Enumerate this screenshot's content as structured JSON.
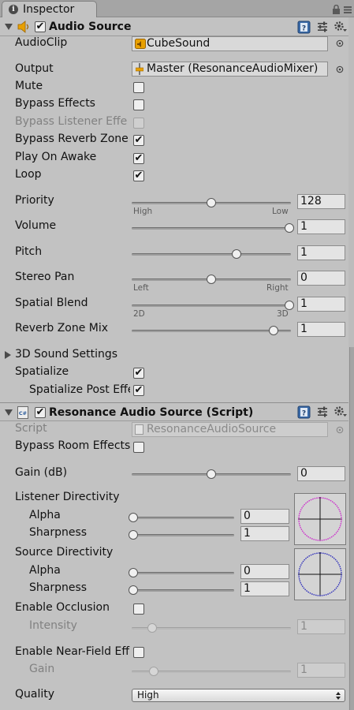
{
  "tab": {
    "title": "Inspector"
  },
  "audio_source": {
    "title": "Audio Source",
    "fields": {
      "audioclip_label": "AudioClip",
      "audioclip_value": "CubeSound",
      "output_label": "Output",
      "output_value": "Master (ResonanceAudioMixer)",
      "mute_label": "Mute",
      "bypass_effects_label": "Bypass Effects",
      "bypass_listener_label": "Bypass Listener Effe",
      "bypass_reverb_label": "Bypass Reverb Zone",
      "play_on_awake_label": "Play On Awake",
      "loop_label": "Loop",
      "priority_label": "Priority",
      "priority_value": "128",
      "priority_min_label": "High",
      "priority_max_label": "Low",
      "volume_label": "Volume",
      "volume_value": "1",
      "pitch_label": "Pitch",
      "pitch_value": "1",
      "stereo_pan_label": "Stereo Pan",
      "stereo_pan_value": "0",
      "stereo_pan_min_label": "Left",
      "stereo_pan_max_label": "Right",
      "spatial_blend_label": "Spatial Blend",
      "spatial_blend_value": "1",
      "spatial_blend_min_label": "2D",
      "spatial_blend_max_label": "3D",
      "reverb_mix_label": "Reverb Zone Mix",
      "reverb_mix_value": "1",
      "sound_settings_label": "3D Sound Settings",
      "spatialize_label": "Spatialize",
      "spatialize_post_label": "Spatialize Post Effe"
    },
    "checks": {
      "enabled": true,
      "mute": false,
      "bypass_effects": false,
      "bypass_listener": false,
      "bypass_reverb": true,
      "play_on_awake": true,
      "loop": true,
      "spatialize": true,
      "spatialize_post": true
    },
    "slider_levels": {
      "priority": 0.5,
      "volume": 1.0,
      "pitch": 0.66,
      "stereo_pan": 0.5,
      "spatial_blend": 1.0,
      "reverb_mix": 0.9
    }
  },
  "resonance": {
    "title": "Resonance Audio Source (Script)",
    "fields": {
      "script_label": "Script",
      "script_value": "ResonanceAudioSource",
      "bypass_room_label": "Bypass Room Effects",
      "gain_label": "Gain (dB)",
      "gain_value": "0",
      "listener_dir_label": "Listener Directivity",
      "listener_alpha_label": "Alpha",
      "listener_alpha_value": "0",
      "listener_sharp_label": "Sharpness",
      "listener_sharp_value": "1",
      "source_dir_label": "Source Directivity",
      "source_alpha_label": "Alpha",
      "source_alpha_value": "0",
      "source_sharp_label": "Sharpness",
      "source_sharp_value": "1",
      "occlusion_label": "Enable Occlusion",
      "intensity_label": "Intensity",
      "intensity_value": "1",
      "nearfield_label": "Enable Near-Field Eff",
      "nf_gain_label": "Gain",
      "nf_gain_value": "1",
      "quality_label": "Quality",
      "quality_value": "High"
    },
    "checks": {
      "enabled": true,
      "bypass_room": false,
      "occlusion": false,
      "nearfield": false
    },
    "slider_levels": {
      "gain": 0.5,
      "listener_alpha": 0.0,
      "listener_sharp": 0.0,
      "source_alpha": 0.0,
      "source_sharp": 0.0,
      "intensity": 0.12,
      "nf_gain": 0.13
    }
  },
  "colors": {
    "panel_bg": "#c2c2c2",
    "listener_circle": "#cc33cc",
    "source_circle": "#3333bb",
    "audio_icon": "#e8a000"
  },
  "icons": [
    "info-icon",
    "lock-icon",
    "menu-icon",
    "foldout-arrow-icon",
    "speaker-icon",
    "help-icon",
    "preset-icon",
    "gear-icon",
    "audio-file-icon",
    "mixer-icon",
    "script-icon",
    "object-picker-icon",
    "dropdown-arrow-icon"
  ]
}
